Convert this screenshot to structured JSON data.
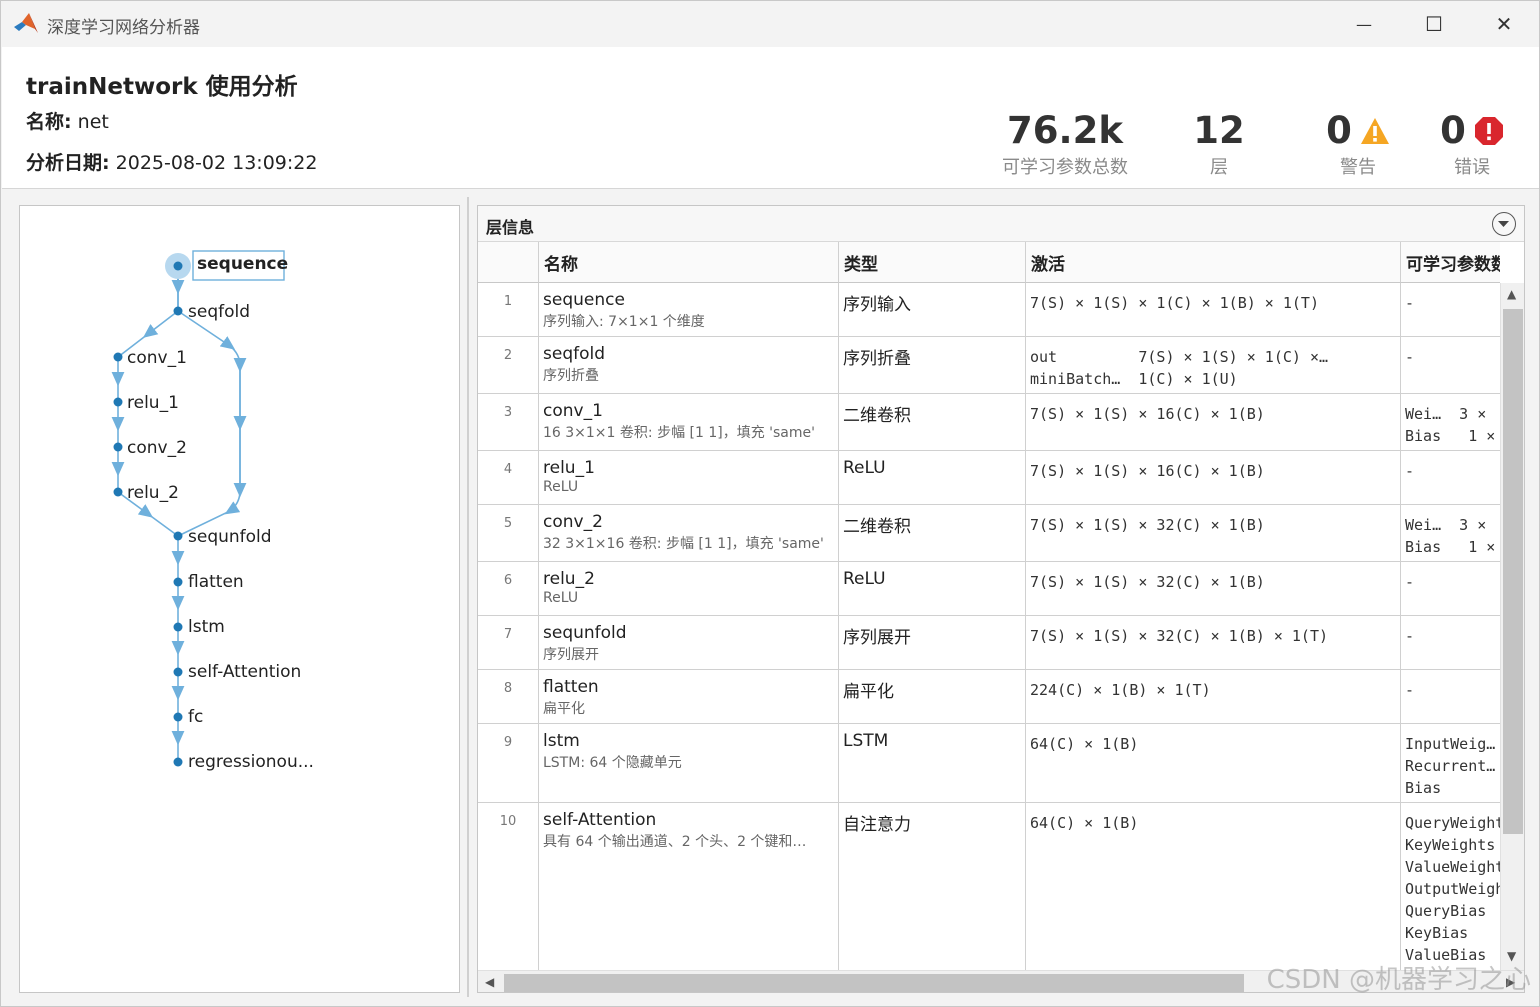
{
  "window": {
    "title": "深度学习网络分析器",
    "minimize_glyph": "—",
    "maximize_glyph": "☐",
    "close_glyph": "✕"
  },
  "header": {
    "title": "trainNetwork 使用分析",
    "name_label": "名称:",
    "name_value": "net",
    "date_label": "分析日期:",
    "date_value": "2025-08-02 13:09:22"
  },
  "stats": [
    {
      "value": "76.2k",
      "label": "可学习参数总数",
      "icon": ""
    },
    {
      "value": "12",
      "label": "层",
      "icon": ""
    },
    {
      "value": "0",
      "label": "警告",
      "icon": "warning-icon"
    },
    {
      "value": "0",
      "label": "错误",
      "icon": "error-icon"
    }
  ],
  "colors": {
    "accent": "#1f78b4",
    "edge": "#6fb0dc",
    "warning": "#f5a623",
    "error": "#d9262d"
  },
  "graph": {
    "nodes": [
      "sequence",
      "seqfold",
      "conv_1",
      "relu_1",
      "conv_2",
      "relu_2",
      "sequnfold",
      "flatten",
      "lstm",
      "self-Attention",
      "fc",
      "regressionou..."
    ],
    "selected": "sequence"
  },
  "table": {
    "panel_title": "层信息",
    "columns": [
      "名称",
      "类型",
      "激活",
      "可学习参数数"
    ],
    "rows": [
      {
        "idx": "1",
        "name": "sequence",
        "desc": "序列输入: 7×1×1 个维度",
        "type": "序列输入",
        "act": "7(S) × 1(S) × 1(C) × 1(B) × 1(T)",
        "params": "-"
      },
      {
        "idx": "2",
        "name": "seqfold",
        "desc": "序列折叠",
        "type": "序列折叠",
        "act": "out         7(S) × 1(S) × 1(C) ×…\nminiBatch…  1(C) × 1(U)",
        "params": "-"
      },
      {
        "idx": "3",
        "name": "conv_1",
        "desc": "16 3×1×1 卷积: 步幅 [1 1]，填充 'same'",
        "type": "二维卷积",
        "act": "7(S) × 1(S) × 16(C) × 1(B)",
        "params": "Wei…  3 ×\nBias   1 ×"
      },
      {
        "idx": "4",
        "name": "relu_1",
        "desc": "ReLU",
        "type": "ReLU",
        "act": "7(S) × 1(S) × 16(C) × 1(B)",
        "params": "-"
      },
      {
        "idx": "5",
        "name": "conv_2",
        "desc": "32 3×1×16 卷积: 步幅 [1 1]，填充 'same'",
        "type": "二维卷积",
        "act": "7(S) × 1(S) × 32(C) × 1(B)",
        "params": "Wei…  3 ×\nBias   1 ×"
      },
      {
        "idx": "6",
        "name": "relu_2",
        "desc": "ReLU",
        "type": "ReLU",
        "act": "7(S) × 1(S) × 32(C) × 1(B)",
        "params": "-"
      },
      {
        "idx": "7",
        "name": "sequnfold",
        "desc": "序列展开",
        "type": "序列展开",
        "act": "7(S) × 1(S) × 32(C) × 1(B) × 1(T)",
        "params": "-"
      },
      {
        "idx": "8",
        "name": "flatten",
        "desc": "扁平化",
        "type": "扁平化",
        "act": "224(C) × 1(B) × 1(T)",
        "params": "-"
      },
      {
        "idx": "9",
        "name": "lstm",
        "desc": "LSTM: 64 个隐藏单元",
        "type": "LSTM",
        "act": "64(C) × 1(B)",
        "params": "InputWeig…\nRecurrent…\nBias"
      },
      {
        "idx": "10",
        "name": "self-Attention",
        "desc": "具有 64 个输出通道、2 个头、2 个键和…",
        "type": "自注意力",
        "act": "64(C) × 1(B)",
        "params": "QueryWeights\nKeyWeights\nValueWeights\nOutputWeights\nQueryBias\nKeyBias\nValueBias\nOutputBias"
      }
    ]
  },
  "watermark": "CSDN @机器学习之心"
}
